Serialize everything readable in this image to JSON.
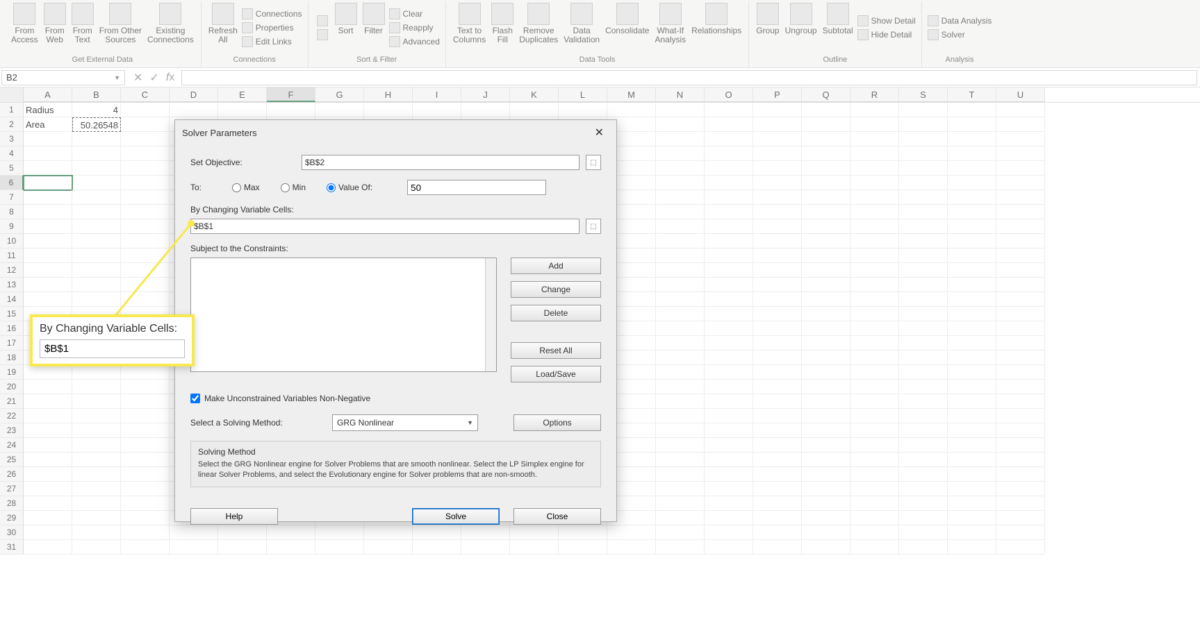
{
  "ribbon": {
    "groups": {
      "ged": {
        "label": "Get External Data",
        "from_access": "From\nAccess",
        "from_web": "From\nWeb",
        "from_text": "From\nText",
        "from_other": "From Other\nSources",
        "existing": "Existing\nConnections"
      },
      "conn": {
        "label": "Connections",
        "refresh": "Refresh\nAll",
        "connections": "Connections",
        "properties": "Properties",
        "edit_links": "Edit Links"
      },
      "sort": {
        "label": "Sort & Filter",
        "sort": "Sort",
        "filter": "Filter",
        "clear": "Clear",
        "reapply": "Reapply",
        "advanced": "Advanced"
      },
      "tools": {
        "label": "Data Tools",
        "text_to_cols": "Text to\nColumns",
        "flash": "Flash\nFill",
        "remove_dup": "Remove\nDuplicates",
        "validation": "Data\nValidation",
        "consolidate": "Consolidate",
        "whatif": "What-If\nAnalysis",
        "relationships": "Relationships"
      },
      "outline": {
        "label": "Outline",
        "group": "Group",
        "ungroup": "Ungroup",
        "subtotal": "Subtotal",
        "show_detail": "Show Detail",
        "hide_detail": "Hide Detail"
      },
      "analysis": {
        "label": "Analysis",
        "data_analysis": "Data Analysis",
        "solver": "Solver"
      }
    }
  },
  "namebox": "B2",
  "sheet": {
    "cols": [
      "A",
      "B",
      "C",
      "D",
      "E",
      "F",
      "G",
      "H",
      "I",
      "J",
      "K",
      "L",
      "M",
      "N",
      "O",
      "P",
      "Q",
      "R",
      "S",
      "T",
      "U"
    ],
    "r1a": "Radius",
    "r1b": "4",
    "r2a": "Area",
    "r2b": "50.26548"
  },
  "dialog": {
    "title": "Solver Parameters",
    "set_objective_label": "Set Objective:",
    "set_objective_value": "$B$2",
    "to_label": "To:",
    "opt_max": "Max",
    "opt_min": "Min",
    "opt_value_of": "Value Of:",
    "value_of_input": "50",
    "by_changing_label": "By Changing Variable Cells:",
    "by_changing_value": "$B$1",
    "constraints_label": "Subject to the Constraints:",
    "btn_add": "Add",
    "btn_change": "Change",
    "btn_delete": "Delete",
    "btn_reset": "Reset All",
    "btn_loadsave": "Load/Save",
    "chk_nonneg": "Make Unconstrained Variables Non-Negative",
    "method_label": "Select a Solving Method:",
    "method_value": "GRG Nonlinear",
    "btn_options": "Options",
    "help_title": "Solving Method",
    "help_body": "Select the GRG Nonlinear engine for Solver Problems that are smooth nonlinear. Select the LP Simplex engine for linear Solver Problems, and select the Evolutionary engine for Solver problems that are non-smooth.",
    "btn_help": "Help",
    "btn_solve": "Solve",
    "btn_close": "Close"
  },
  "callout": {
    "label": "By Changing Variable Cells:",
    "value": "$B$1"
  }
}
